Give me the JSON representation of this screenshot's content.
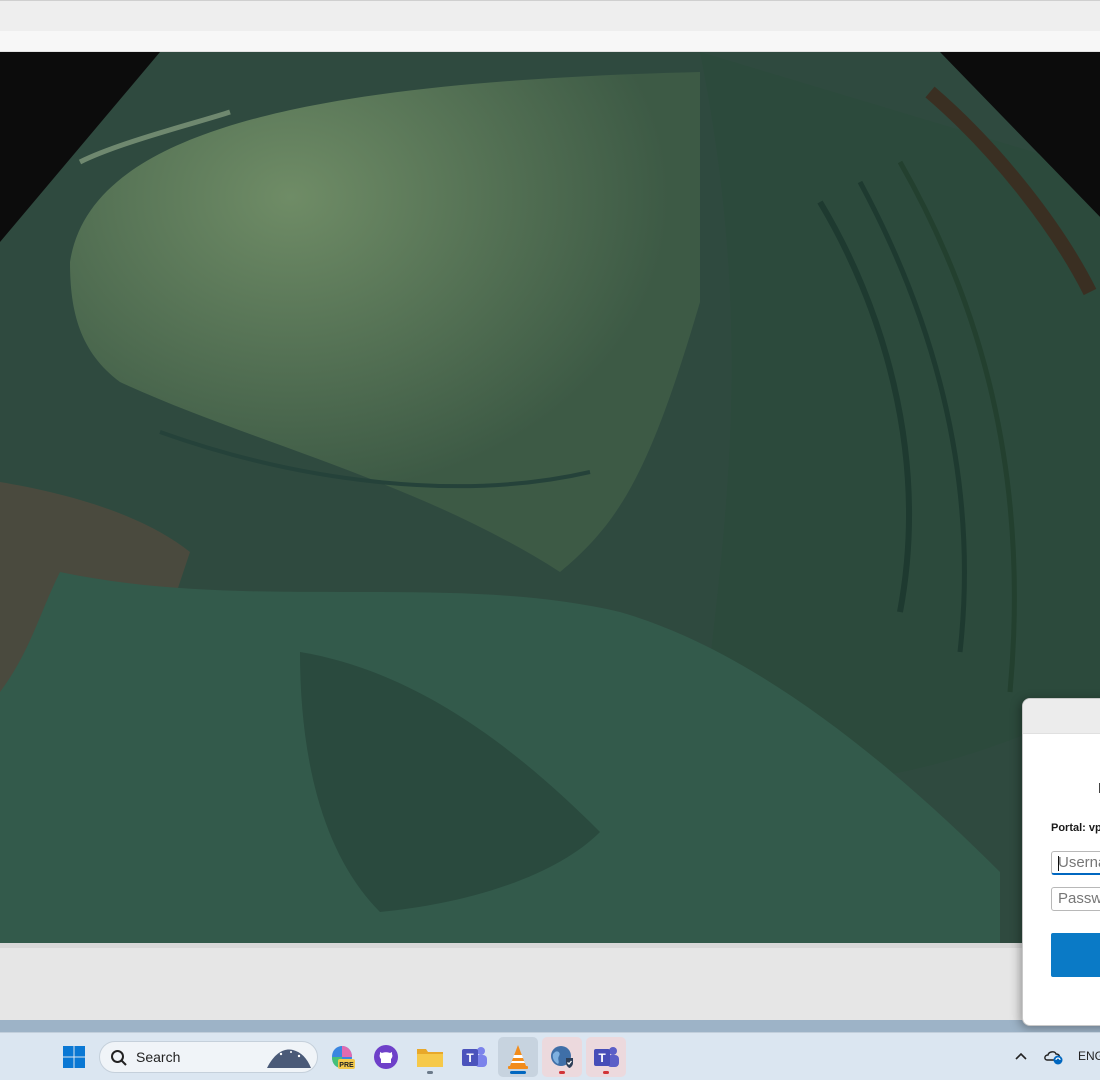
{
  "taskbar": {
    "search_placeholder": "Search",
    "language": "ENG",
    "apps": [
      {
        "name": "Start",
        "icon": "windows-logo-icon"
      },
      {
        "name": "Copilot (Pre)",
        "icon": "copilot-pre-icon",
        "badge": "PRE"
      },
      {
        "name": "GitHub",
        "icon": "github-icon"
      },
      {
        "name": "File Explorer",
        "icon": "folder-icon"
      },
      {
        "name": "Teams",
        "icon": "teams-icon",
        "letter": "T"
      },
      {
        "name": "VLC media player",
        "icon": "vlc-cone-icon",
        "active": true
      },
      {
        "name": "VPN client",
        "icon": "globe-shield-icon"
      },
      {
        "name": "Teams (work)",
        "icon": "teams-work-icon",
        "letter": "T"
      }
    ],
    "tray_icons": [
      "chevron-up-icon",
      "onedrive-sync-icon"
    ]
  },
  "vpn_dialog": {
    "portal_label": "Portal: vp",
    "username_placeholder": "Userna",
    "password_placeholder": "Passwo"
  },
  "colors": {
    "accent": "#0067c0",
    "connect_button": "#0a7ac6",
    "video_tint": "#4e6a4a"
  }
}
